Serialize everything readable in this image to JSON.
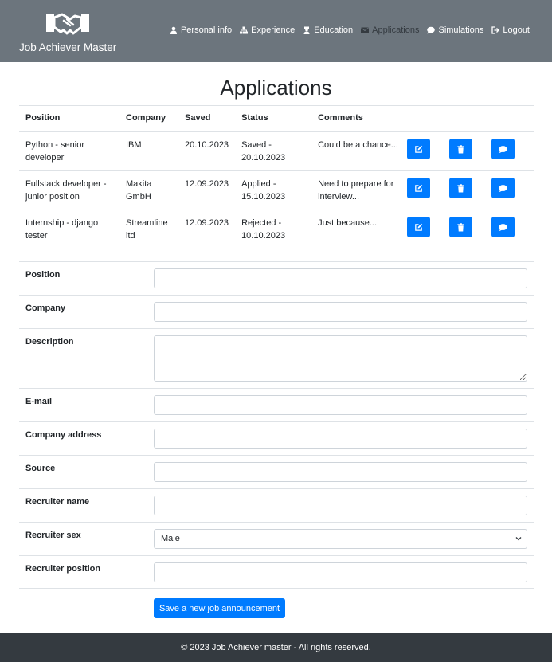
{
  "header": {
    "brand": "Job Achiever Master",
    "nav": [
      {
        "label": "Personal info",
        "icon": "user-icon",
        "active": false
      },
      {
        "label": "Experience",
        "icon": "sitemap-icon",
        "active": false
      },
      {
        "label": "Education",
        "icon": "graduate-icon",
        "active": false
      },
      {
        "label": "Applications",
        "icon": "envelope-icon",
        "active": true
      },
      {
        "label": "Simulations",
        "icon": "comment-icon",
        "active": false
      },
      {
        "label": "Logout",
        "icon": "logout-icon",
        "active": false
      }
    ]
  },
  "page": {
    "title": "Applications"
  },
  "table": {
    "headers": [
      "Position",
      "Company",
      "Saved",
      "Status",
      "Comments"
    ],
    "rows": [
      {
        "position": "Python - senior developer",
        "company": "IBM",
        "saved": "20.10.2023",
        "status": "Saved - 20.10.2023",
        "comments": "Could be a chance..."
      },
      {
        "position": "Fullstack developer - junior position",
        "company": "Makita GmbH",
        "saved": "12.09.2023",
        "status": "Applied - 15.10.2023",
        "comments": "Need to prepare for interview..."
      },
      {
        "position": "Internship - django tester",
        "company": "Streamline ltd",
        "saved": "12.09.2023",
        "status": "Rejected - 10.10.2023",
        "comments": "Just because..."
      }
    ],
    "action_icons": [
      "edit-icon",
      "trash-icon",
      "comment-icon"
    ]
  },
  "form": {
    "position_label": "Position",
    "company_label": "Company",
    "description_label": "Description",
    "email_label": "E-mail",
    "company_address_label": "Company address",
    "source_label": "Source",
    "recruiter_name_label": "Recruiter name",
    "recruiter_sex_label": "Recruiter sex",
    "recruiter_sex_value": "Male",
    "recruiter_position_label": "Recruiter position",
    "submit_label": "Save a new job announcement"
  },
  "footer": {
    "text": "© 2023 Job Achiever master - All rights reserved."
  },
  "colors": {
    "header_bg": "#6c757d",
    "footer_bg": "#343a40",
    "primary": "#007bff",
    "active_nav": "#343a40"
  }
}
